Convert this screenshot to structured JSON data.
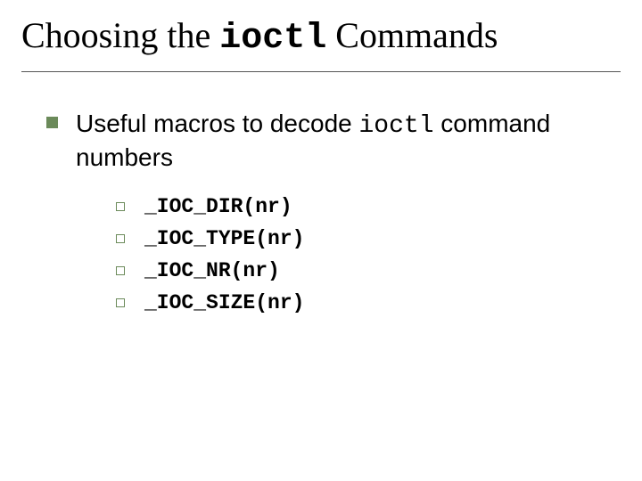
{
  "title": {
    "pre": "Choosing the ",
    "code": "ioctl",
    "post": " Commands"
  },
  "bullet": {
    "pre": "Useful macros to decode ",
    "code": "ioctl",
    "post": " command numbers"
  },
  "macros": [
    "_IOC_DIR(nr)",
    "_IOC_TYPE(nr)",
    "_IOC_NR(nr)",
    "_IOC_SIZE(nr)"
  ]
}
